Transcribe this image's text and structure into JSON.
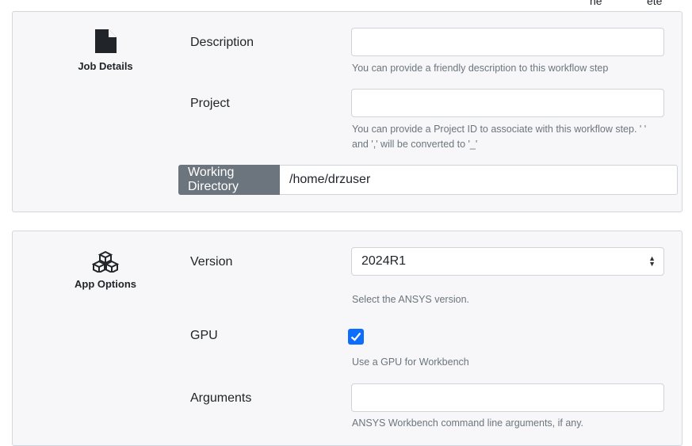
{
  "top_fragments": {
    "left": "ne",
    "right": "ete"
  },
  "job_details": {
    "section_label": "Job Details",
    "icon": "file-icon",
    "description": {
      "label": "Description",
      "value": "",
      "help": "You can provide a friendly description to this workflow step"
    },
    "project": {
      "label": "Project",
      "value": "",
      "help": "You can provide a Project ID to associate with this workflow step. ' ' and ',' will be converted to '_'"
    },
    "working_directory": {
      "label": "Working Directory",
      "value": "/home/drzuser"
    }
  },
  "app_options": {
    "section_label": "App Options",
    "icon": "cubes-icon",
    "version": {
      "label": "Version",
      "value": "2024R1",
      "help": "Select the ANSYS version."
    },
    "gpu": {
      "label": "GPU",
      "checked": true,
      "help": "Use a GPU for Workbench"
    },
    "arguments": {
      "label": "Arguments",
      "value": "",
      "help": "ANSYS Workbench command line arguments, if any."
    }
  },
  "colors": {
    "accent": "#0d6efd",
    "addon": "#6c757d",
    "card_bg": "#f7f7f9"
  }
}
